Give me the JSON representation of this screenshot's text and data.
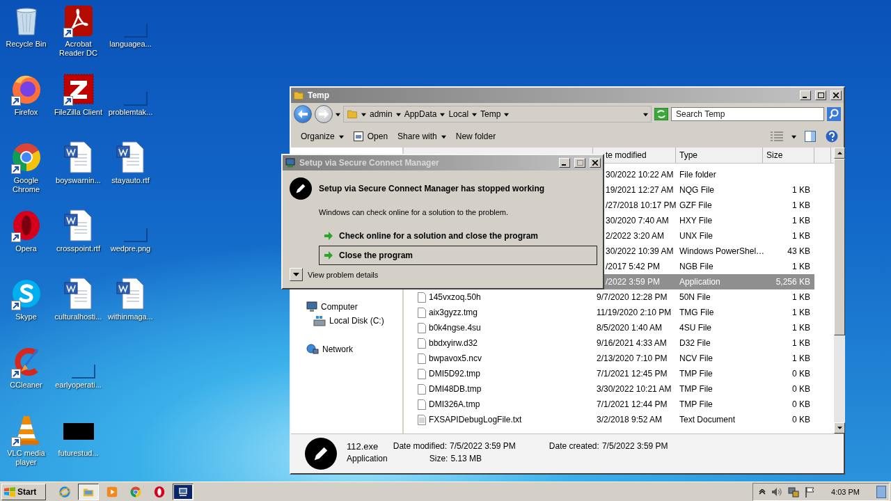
{
  "desktop_icons": [
    {
      "label": "Recycle Bin",
      "kind": "recycle",
      "shortcut": false
    },
    {
      "label": "Firefox",
      "kind": "firefox",
      "shortcut": true
    },
    {
      "label": "Google\nChrome",
      "kind": "chrome",
      "shortcut": true
    },
    {
      "label": "Opera",
      "kind": "opera",
      "shortcut": true
    },
    {
      "label": "Skype",
      "kind": "skype",
      "shortcut": true
    },
    {
      "label": "CCleaner",
      "kind": "ccleaner",
      "shortcut": true
    },
    {
      "label": "VLC media\nplayer",
      "kind": "vlc",
      "shortcut": true
    },
    {
      "label": "Acrobat\nReader DC",
      "kind": "acrobat",
      "shortcut": true
    },
    {
      "label": "FileZilla Client",
      "kind": "filezilla",
      "shortcut": true
    },
    {
      "label": "boyswarnin...",
      "kind": "word",
      "shortcut": false
    },
    {
      "label": "crosspoint.rtf",
      "kind": "word",
      "shortcut": false
    },
    {
      "label": "culturalhosti...",
      "kind": "word",
      "shortcut": false
    },
    {
      "label": "earlyoperati...",
      "kind": "blank",
      "shortcut": false
    },
    {
      "label": "futurestud...",
      "kind": "black",
      "shortcut": false
    },
    {
      "label": "languagea...",
      "kind": "blank",
      "shortcut": false
    },
    {
      "label": "problemtak...",
      "kind": "blank",
      "shortcut": false
    },
    {
      "label": "stayauto.rtf",
      "kind": "word",
      "shortcut": false
    },
    {
      "label": "wedpre.png",
      "kind": "blank",
      "shortcut": false
    },
    {
      "label": "withinmaga...",
      "kind": "word",
      "shortcut": false
    }
  ],
  "explorer": {
    "title": "Temp",
    "breadcrumbs": [
      "admin",
      "AppData",
      "Local",
      "Temp"
    ],
    "search": {
      "placeholder": "Search Temp"
    },
    "toolbar": [
      {
        "label": "Organize",
        "kind": "menu"
      },
      {
        "label": "Open",
        "kind": "open"
      },
      {
        "label": "Share with",
        "kind": "menu"
      },
      {
        "label": "New folder",
        "kind": "plain"
      }
    ],
    "nav": [
      {
        "label": "Computer",
        "kind": "computer",
        "children": [
          {
            "label": "Local Disk (C:)",
            "kind": "disk"
          }
        ]
      },
      {
        "label": "Network",
        "kind": "network"
      }
    ],
    "columns": [
      "te modified",
      "Type",
      "Size"
    ],
    "rows": [
      {
        "kind": "covered",
        "date": "30/2022 10:22 AM",
        "type": "File folder",
        "selected": false
      },
      {
        "kind": "covered",
        "date": "19/2021 12:27 AM",
        "type": "NQG File",
        "size": "1 KB",
        "selected": false
      },
      {
        "kind": "covered",
        "date": "/27/2018 10:17 PM",
        "type": "GZF File",
        "size": "1 KB",
        "selected": false
      },
      {
        "kind": "covered",
        "date": "30/2020 7:40 AM",
        "type": "HXY File",
        "size": "1 KB",
        "selected": false
      },
      {
        "kind": "covered",
        "date": "2/2022 3:20 AM",
        "type": "UNX File",
        "size": "1 KB",
        "selected": false
      },
      {
        "kind": "covered",
        "date": "30/2022 10:39 AM",
        "type": "Windows PowerShel…",
        "size": "43 KB",
        "selected": false
      },
      {
        "kind": "covered",
        "date": "/2017 5:42 PM",
        "type": "NGB File",
        "size": "1 KB",
        "selected": false
      },
      {
        "kind": "covered",
        "date": "/2022 3:59 PM",
        "type": "Application",
        "size": "5,256 KB",
        "selected": true
      },
      {
        "kind": "file",
        "name": "145vxzoq.50h",
        "date": "9/7/2020 12:28 PM",
        "type": "50N File",
        "size": "1 KB",
        "selected": false
      },
      {
        "kind": "file",
        "name": "aix3gyzz.tmg",
        "date": "11/19/2020 2:10 PM",
        "type": "TMG File",
        "size": "1 KB",
        "selected": false
      },
      {
        "kind": "file",
        "name": "b0k4ngse.4su",
        "date": "8/5/2020 1:40 AM",
        "type": "4SU File",
        "size": "1 KB",
        "selected": false
      },
      {
        "kind": "file",
        "name": "bbdxyirw.d32",
        "date": "9/16/2021 4:33 AM",
        "type": "D32 File",
        "size": "1 KB",
        "selected": false
      },
      {
        "kind": "file",
        "name": "bwpavox5.ncv",
        "date": "2/13/2020 7:10 PM",
        "type": "NCV File",
        "size": "1 KB",
        "selected": false
      },
      {
        "kind": "file",
        "name": "DMI5D92.tmp",
        "date": "7/1/2021 12:45 PM",
        "type": "TMP File",
        "size": "0 KB",
        "selected": false
      },
      {
        "kind": "file",
        "name": "DMI48DB.tmp",
        "date": "3/30/2022 10:21 AM",
        "type": "TMP File",
        "size": "0 KB",
        "selected": false
      },
      {
        "kind": "file",
        "name": "DMI326A.tmp",
        "date": "7/1/2021 12:44 PM",
        "type": "TMP File",
        "size": "0 KB",
        "selected": false
      },
      {
        "kind": "text",
        "name": "FXSAPIDebugLogFile.txt",
        "date": "3/2/2018 9:52 AM",
        "type": "Text Document",
        "size": "0 KB",
        "selected": false
      }
    ],
    "details": {
      "name": "112.exe",
      "type": "Application",
      "modified_label": "Date modified:",
      "modified": "7/5/2022 3:59 PM",
      "created_label": "Date created:",
      "created": "7/5/2022 3:59 PM",
      "size_label": "Size:",
      "size": "5.13 MB"
    }
  },
  "dialog": {
    "title": "Setup via Secure Connect Manager",
    "heading": "Setup via Secure Connect Manager has stopped working",
    "message": "Windows can check online for a solution to the problem.",
    "options": [
      {
        "label": "Check online for a solution and close the program",
        "selected": false
      },
      {
        "label": "Close the program",
        "selected": true
      }
    ],
    "details_toggle": "View problem details"
  },
  "taskbar": {
    "start": "Start",
    "apps": [
      {
        "kind": "ie",
        "selected": false
      },
      {
        "kind": "explorer",
        "selected": true
      },
      {
        "kind": "media",
        "selected": false
      },
      {
        "kind": "chrome",
        "selected": false
      },
      {
        "kind": "opera",
        "selected": false
      },
      {
        "kind": "setup",
        "selected": true
      }
    ],
    "clock": "4:03 PM"
  }
}
